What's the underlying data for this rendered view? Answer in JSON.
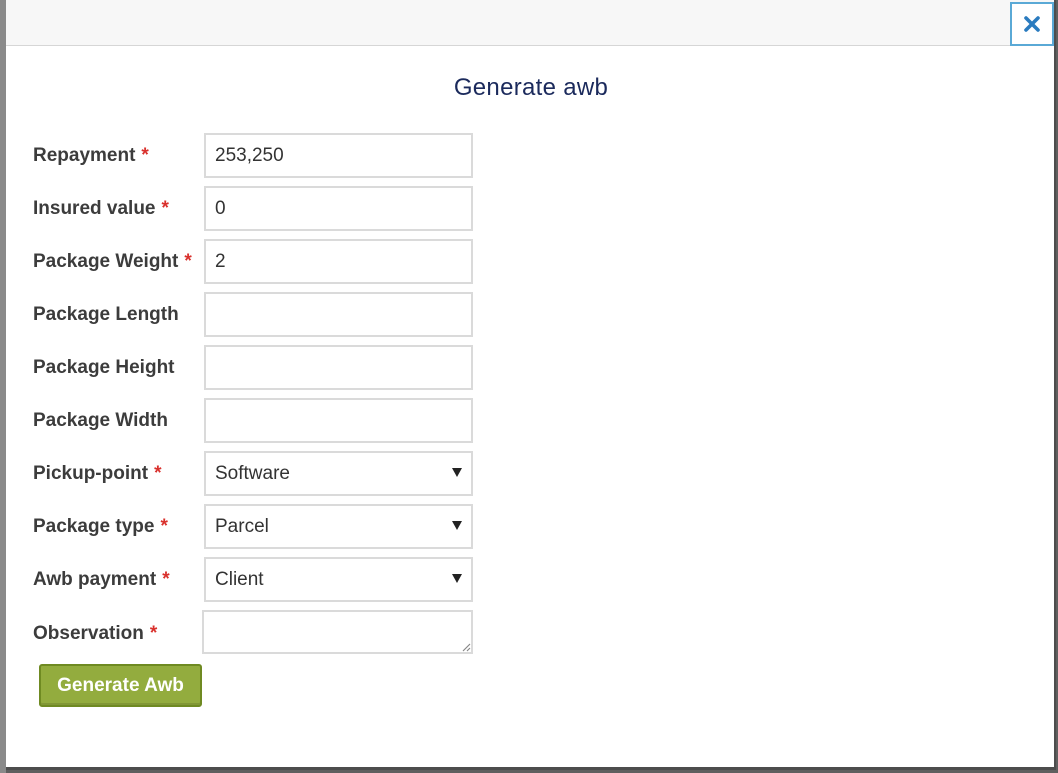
{
  "modal": {
    "title": "Generate awb",
    "close_icon": "close-icon",
    "accent_color": "#1b2a5c",
    "required_marker": "*",
    "required_color": "#d9302c"
  },
  "fields": {
    "repayment": {
      "label": "Repayment",
      "value": "253,250",
      "required": true
    },
    "insured_value": {
      "label": "Insured value",
      "value": "0",
      "required": true
    },
    "package_weight": {
      "label": "Package Weight",
      "value": "2",
      "required": true
    },
    "package_length": {
      "label": "Package Length",
      "value": "",
      "required": false
    },
    "package_height": {
      "label": "Package Height",
      "value": "",
      "required": false
    },
    "package_width": {
      "label": "Package Width",
      "value": "",
      "required": false
    },
    "pickup_point": {
      "label": "Pickup-point",
      "value": "Software",
      "required": true
    },
    "package_type": {
      "label": "Package type",
      "value": "Parcel",
      "required": true
    },
    "awb_payment": {
      "label": "Awb payment",
      "value": "Client",
      "required": true
    },
    "observation": {
      "label": "Observation",
      "value": "",
      "required": true
    }
  },
  "actions": {
    "submit_label": "Generate Awb",
    "submit_color": "#93ac3e"
  }
}
